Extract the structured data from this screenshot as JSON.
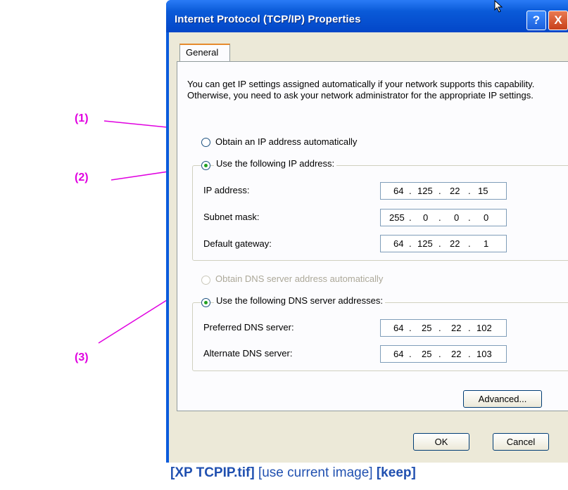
{
  "window": {
    "title": "Internet Protocol (TCP/IP) Properties",
    "help_label": "?",
    "close_label": "X"
  },
  "tabs": [
    {
      "label": "General",
      "selected": true
    }
  ],
  "intro_text": "You can get IP settings assigned automatically if your network supports this capability. Otherwise, you need to ask your network administrator for the appropriate IP settings.",
  "ip": {
    "auto_label": "Obtain an IP address automatically",
    "auto_selected": false,
    "manual_label": "Use the following IP address:",
    "manual_selected": true,
    "fields": [
      {
        "label": "IP address:",
        "octets": [
          "64",
          "125",
          "22",
          "15"
        ]
      },
      {
        "label": "Subnet mask:",
        "octets": [
          "255",
          "0",
          "0",
          "0"
        ]
      },
      {
        "label": "Default gateway:",
        "octets": [
          "64",
          "125",
          "22",
          "1"
        ]
      }
    ]
  },
  "dns": {
    "auto_label": "Obtain DNS server address automatically",
    "auto_enabled": false,
    "manual_label": "Use the following DNS server addresses:",
    "manual_selected": true,
    "fields": [
      {
        "label": "Preferred DNS server:",
        "octets": [
          "64",
          "25",
          "22",
          "102"
        ]
      },
      {
        "label": "Alternate DNS server:",
        "octets": [
          "64",
          "25",
          "22",
          "103"
        ]
      }
    ]
  },
  "buttons": {
    "advanced": "Advanced...",
    "ok": "OK",
    "cancel": "Cancel"
  },
  "annotations": {
    "one": "(1)",
    "two": "(2)",
    "three": "(3)",
    "color": "#e000e0"
  },
  "caption": {
    "file": "[XP TCPIP.tif]",
    "note": "[use current image]",
    "keep": "[keep]"
  }
}
